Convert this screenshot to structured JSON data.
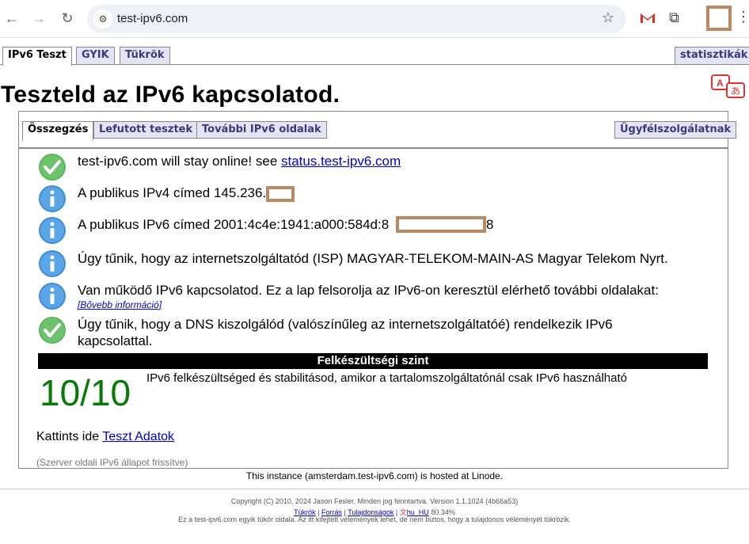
{
  "browser": {
    "url": "test-ipv6.com",
    "back_icon": "back-arrow-icon",
    "forward_icon": "forward-arrow-icon",
    "reload_icon": "reload-icon",
    "star_icon": "bookmark-star-icon",
    "gmail_icon": "gmail-icon",
    "extensions_icon": "puzzle-icon",
    "menu_icon": "kebab-menu-icon"
  },
  "top_tabs": {
    "ipv6_test": "IPv6 Teszt",
    "faq": "GYIK",
    "mirrors": "Tükrök",
    "stats": "statisztikák"
  },
  "heading": "Teszteld az IPv6 kapcsolatod.",
  "inner_tabs": {
    "summary": "Összegzés",
    "tests_run": "Lefutott tesztek",
    "more_sites": "További IPv6 oldalak",
    "help_desk": "Ügyfélszolgálatnak"
  },
  "results": {
    "online_text": "test-ipv6.com will stay online! see ",
    "online_link": "status.test-ipv6.com",
    "ipv4_text": "A publikus IPv4 címed 145.236.",
    "ipv6_text": "A publikus IPv6 címed 2001:4c4e:1941:a000:584d:8",
    "ipv6_suffix": "8",
    "isp_text": "Úgy tűnik, hogy az internetszolgáltatód (ISP) MAGYAR-TELEKOM-MAIN-AS Magyar Telekom Nyrt.",
    "ipv6_working_text": "Van működő IPv6 kapcsolatod. Ez a lap felsorolja az IPv6-on keresztül elérhető további oldalakat:",
    "more_info_link": "[Bővebb információ]",
    "dns_text_line1": "Úgy tűnik, hogy a DNS kiszolgálód (valószínűleg az internetszolgáltatóé) rendelkezik IPv6",
    "dns_text_line2": "kapcsolattal."
  },
  "readiness": {
    "banner": "Felkészültségi szint",
    "score": "10/10",
    "description": "IPv6 felkészültséged és stabilitásod, amikor a tartalomszolgáltatónál csak IPv6 használható"
  },
  "click_here": {
    "prefix": "Kattints ide ",
    "link": "Teszt Adatok"
  },
  "server_note": "(Szerver oldali IPv6 állapot frissítve)",
  "hosted": "This instance (amsterdam.test-ipv6.com) is hosted at Linode.",
  "footer": {
    "copyright": "Copyright (C) 2010, 2024 Jason Fesler. Minden jog fenntartva. Version 1.1.1024 (4b66a53)",
    "mirrors": "Tükrök",
    "source": "Forrás",
    "ownership": "Tulajdonságok",
    "locale": "hu_HU",
    "locale_pct": "80.34%",
    "disclaimer": "Ez a test-ipv6.com egyik tükör oldala. Az itt kifejtett vélemények lehet, de nem biztos, hogy a tulajdonos véleményét tükrözik."
  },
  "colors": {
    "tab_bg": "#e4e4f4",
    "score_green": "#097a09",
    "link_blue": "#0000cc",
    "redaction": "#b98a64"
  }
}
